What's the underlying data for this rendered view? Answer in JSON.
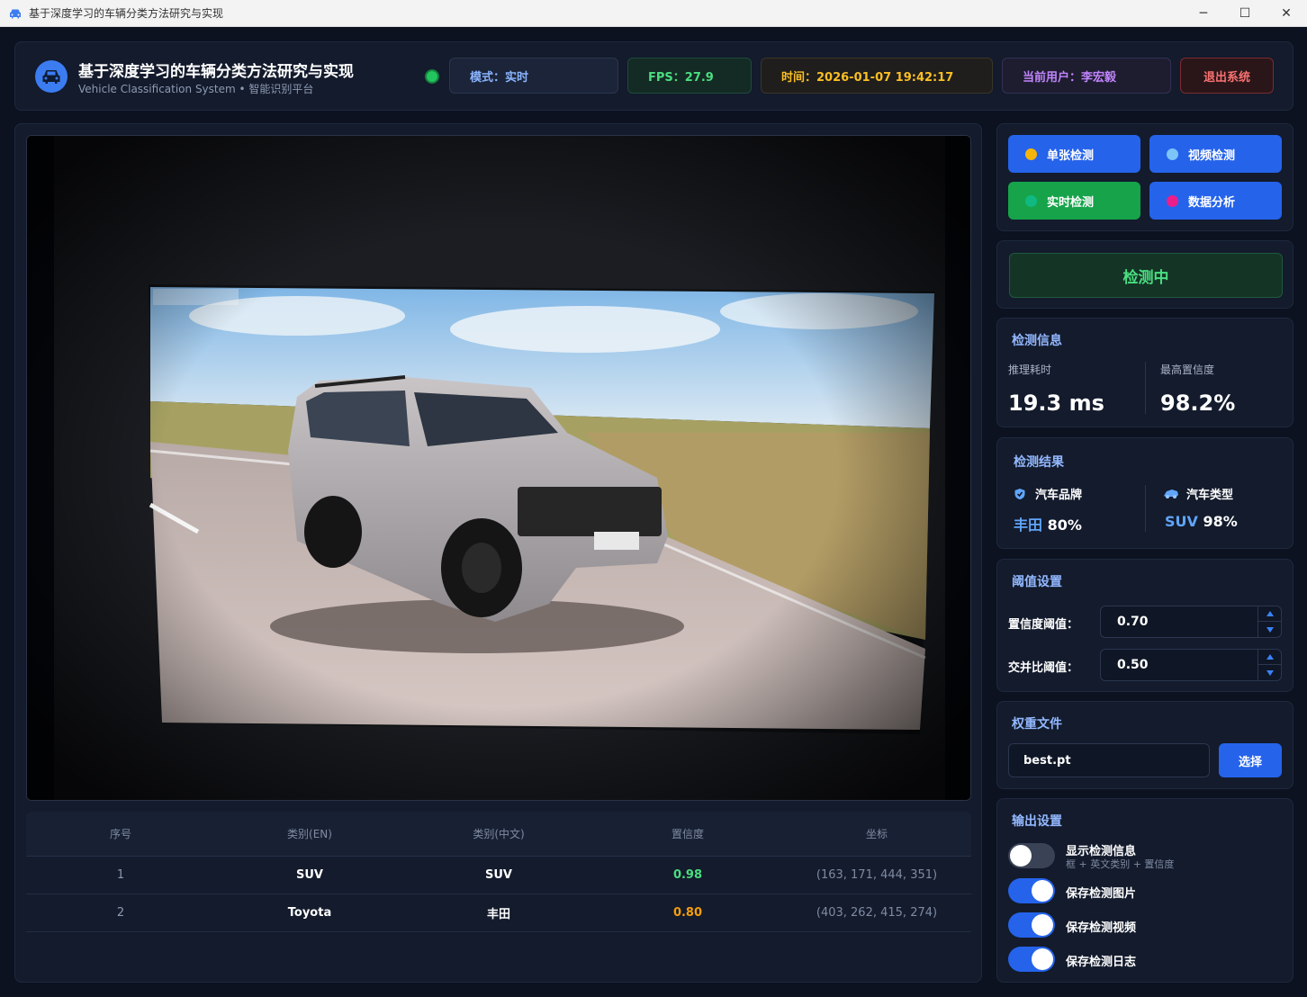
{
  "window": {
    "title": "基于深度学习的车辆分类方法研究与实现",
    "minimize": "─",
    "maximize": "☐",
    "close": "✕"
  },
  "header": {
    "title": "基于深度学习的车辆分类方法研究与实现",
    "subtitle": "Vehicle Classification System • 智能识别平台",
    "mode": "模式：实时",
    "fps": "FPS：27.9",
    "time": "时间：2026-01-07 19:42:17",
    "user": "当前用户：李宏毅",
    "logout": "退出系统"
  },
  "table": {
    "headers": [
      "序号",
      "类别(EN)",
      "类别(中文)",
      "置信度",
      "坐标"
    ],
    "rows": [
      {
        "idx": "1",
        "en": "SUV",
        "cn": "SUV",
        "conf": "0.98",
        "coord": "(163, 171, 444, 351)"
      },
      {
        "idx": "2",
        "en": "Toyota",
        "cn": "丰田",
        "conf": "0.80",
        "coord": "(403, 262, 415, 274)"
      }
    ]
  },
  "modes": {
    "single": "单张检测",
    "video": "视频检测",
    "realtime": "实时检测",
    "analysis": "数据分析"
  },
  "status": "检测中",
  "detect_info": {
    "title": "检测信息",
    "latency_label": "推理耗时",
    "latency_value": "19.3 ms",
    "max_conf_label": "最高置信度",
    "max_conf_value": "98.2%"
  },
  "result": {
    "title": "检测结果",
    "brand_label": "汽车品牌",
    "brand_name": "丰田",
    "brand_conf": "80%",
    "type_label": "汽车类型",
    "type_name": "SUV",
    "type_conf": "98%"
  },
  "threshold": {
    "title": "阈值设置",
    "conf_label": "置信度阈值：",
    "conf_value": "0.70",
    "iou_label": "交并比阈值：",
    "iou_value": "0.50"
  },
  "weights": {
    "title": "权重文件",
    "file": "best.pt",
    "choose": "选择"
  },
  "output": {
    "title": "输出设置",
    "show_info": "显示检测信息",
    "show_info_desc": "框 + 英文类别 + 置信度",
    "save_image": "保存检测图片",
    "save_video": "保存检测视频",
    "save_log": "保存检测日志",
    "toggles": {
      "show_info": false,
      "save_image": true,
      "save_video": true,
      "save_log": true
    }
  },
  "colors": {
    "accent": "#2563eb",
    "success": "#22c55e",
    "warning": "#fbbf24",
    "danger": "#f87171",
    "conf_high": "#4ade80",
    "conf_mid": "#f59e0b"
  }
}
